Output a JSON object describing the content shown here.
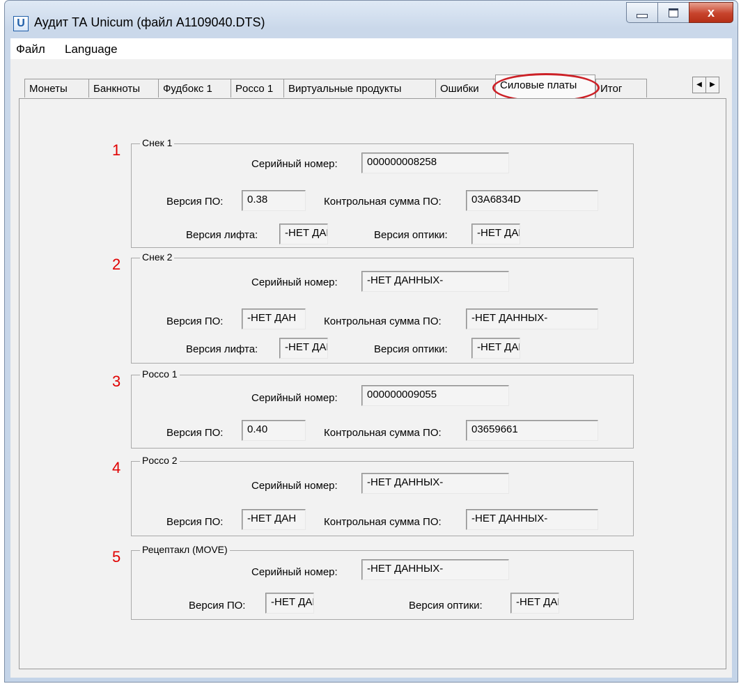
{
  "window": {
    "icon": "unicum-app-icon",
    "app_icon_glyph": "U",
    "title": "Аудит ТА Unicum (файл A1109040.DTS)",
    "close_glyph": "x"
  },
  "menu": [
    {
      "label": "Файл"
    },
    {
      "label": "Language"
    }
  ],
  "tabs": [
    {
      "label": "Монеты"
    },
    {
      "label": "Банкноты"
    },
    {
      "label": "Фудбокс 1"
    },
    {
      "label": "Рocco 1"
    },
    {
      "label": "Виртуальные продукты"
    },
    {
      "label": "Ошибки"
    },
    {
      "label": "Силовые платы",
      "active": true
    },
    {
      "label": "Итог"
    }
  ],
  "tab_scroll": {
    "left": "◀",
    "right": "▶"
  },
  "labels": {
    "serial": "Серийный номер:",
    "fw_version": "Версия ПО:",
    "fw_checksum": "Контрольная сумма ПО:",
    "lift_version": "Версия лифта:",
    "optics_version": "Версия оптики:"
  },
  "groups": [
    {
      "number": "1",
      "title": "Снек 1",
      "serial": "000000008258",
      "fw_version": "0.38",
      "fw_checksum": "03A6834D",
      "lift_version": "-НЕТ ДАН",
      "optics_version": "-НЕТ ДАН"
    },
    {
      "number": "2",
      "title": "Снек 2",
      "serial": "-НЕТ ДАННЫХ-",
      "fw_version": "-НЕТ ДАН",
      "fw_checksum": "-НЕТ ДАННЫХ-",
      "lift_version": "-НЕТ ДАН",
      "optics_version": "-НЕТ ДАН"
    },
    {
      "number": "3",
      "title": "Рocco 1",
      "serial": "000000009055",
      "fw_version": "0.40",
      "fw_checksum": "03659661"
    },
    {
      "number": "4",
      "title": "Рocco 2",
      "serial": "-НЕТ ДАННЫХ-",
      "fw_version": "-НЕТ ДАН",
      "fw_checksum": "-НЕТ ДАННЫХ-"
    },
    {
      "number": "5",
      "title": "Рецептакл (MOVE)",
      "serial": "-НЕТ ДАННЫХ-",
      "fw_version": "-НЕТ ДАН",
      "optics_version": "-НЕТ ДАН"
    }
  ],
  "colors": {
    "annotation_red": "#e00000",
    "highlight_ring": "#cc2127"
  }
}
